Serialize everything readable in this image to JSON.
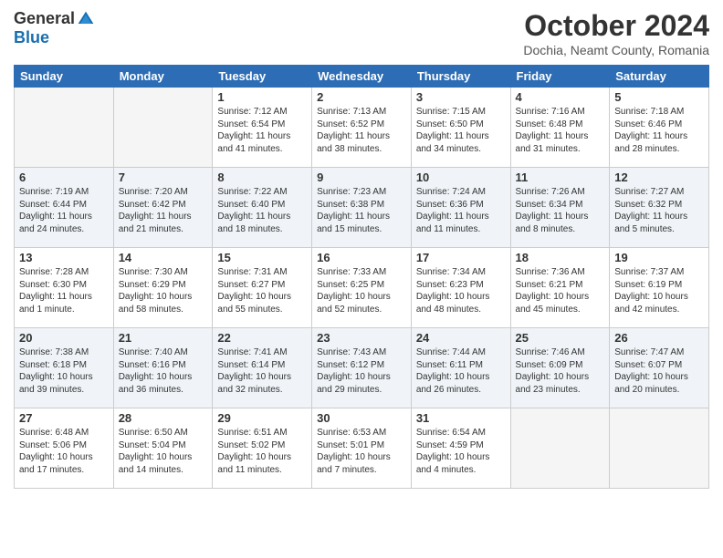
{
  "logo": {
    "general": "General",
    "blue": "Blue"
  },
  "title": "October 2024",
  "location": "Dochia, Neamt County, Romania",
  "weekdays": [
    "Sunday",
    "Monday",
    "Tuesday",
    "Wednesday",
    "Thursday",
    "Friday",
    "Saturday"
  ],
  "weeks": [
    [
      {
        "day": "",
        "empty": true
      },
      {
        "day": "",
        "empty": true
      },
      {
        "day": "1",
        "sunrise": "Sunrise: 7:12 AM",
        "sunset": "Sunset: 6:54 PM",
        "daylight": "Daylight: 11 hours and 41 minutes."
      },
      {
        "day": "2",
        "sunrise": "Sunrise: 7:13 AM",
        "sunset": "Sunset: 6:52 PM",
        "daylight": "Daylight: 11 hours and 38 minutes."
      },
      {
        "day": "3",
        "sunrise": "Sunrise: 7:15 AM",
        "sunset": "Sunset: 6:50 PM",
        "daylight": "Daylight: 11 hours and 34 minutes."
      },
      {
        "day": "4",
        "sunrise": "Sunrise: 7:16 AM",
        "sunset": "Sunset: 6:48 PM",
        "daylight": "Daylight: 11 hours and 31 minutes."
      },
      {
        "day": "5",
        "sunrise": "Sunrise: 7:18 AM",
        "sunset": "Sunset: 6:46 PM",
        "daylight": "Daylight: 11 hours and 28 minutes."
      }
    ],
    [
      {
        "day": "6",
        "sunrise": "Sunrise: 7:19 AM",
        "sunset": "Sunset: 6:44 PM",
        "daylight": "Daylight: 11 hours and 24 minutes."
      },
      {
        "day": "7",
        "sunrise": "Sunrise: 7:20 AM",
        "sunset": "Sunset: 6:42 PM",
        "daylight": "Daylight: 11 hours and 21 minutes."
      },
      {
        "day": "8",
        "sunrise": "Sunrise: 7:22 AM",
        "sunset": "Sunset: 6:40 PM",
        "daylight": "Daylight: 11 hours and 18 minutes."
      },
      {
        "day": "9",
        "sunrise": "Sunrise: 7:23 AM",
        "sunset": "Sunset: 6:38 PM",
        "daylight": "Daylight: 11 hours and 15 minutes."
      },
      {
        "day": "10",
        "sunrise": "Sunrise: 7:24 AM",
        "sunset": "Sunset: 6:36 PM",
        "daylight": "Daylight: 11 hours and 11 minutes."
      },
      {
        "day": "11",
        "sunrise": "Sunrise: 7:26 AM",
        "sunset": "Sunset: 6:34 PM",
        "daylight": "Daylight: 11 hours and 8 minutes."
      },
      {
        "day": "12",
        "sunrise": "Sunrise: 7:27 AM",
        "sunset": "Sunset: 6:32 PM",
        "daylight": "Daylight: 11 hours and 5 minutes."
      }
    ],
    [
      {
        "day": "13",
        "sunrise": "Sunrise: 7:28 AM",
        "sunset": "Sunset: 6:30 PM",
        "daylight": "Daylight: 11 hours and 1 minute."
      },
      {
        "day": "14",
        "sunrise": "Sunrise: 7:30 AM",
        "sunset": "Sunset: 6:29 PM",
        "daylight": "Daylight: 10 hours and 58 minutes."
      },
      {
        "day": "15",
        "sunrise": "Sunrise: 7:31 AM",
        "sunset": "Sunset: 6:27 PM",
        "daylight": "Daylight: 10 hours and 55 minutes."
      },
      {
        "day": "16",
        "sunrise": "Sunrise: 7:33 AM",
        "sunset": "Sunset: 6:25 PM",
        "daylight": "Daylight: 10 hours and 52 minutes."
      },
      {
        "day": "17",
        "sunrise": "Sunrise: 7:34 AM",
        "sunset": "Sunset: 6:23 PM",
        "daylight": "Daylight: 10 hours and 48 minutes."
      },
      {
        "day": "18",
        "sunrise": "Sunrise: 7:36 AM",
        "sunset": "Sunset: 6:21 PM",
        "daylight": "Daylight: 10 hours and 45 minutes."
      },
      {
        "day": "19",
        "sunrise": "Sunrise: 7:37 AM",
        "sunset": "Sunset: 6:19 PM",
        "daylight": "Daylight: 10 hours and 42 minutes."
      }
    ],
    [
      {
        "day": "20",
        "sunrise": "Sunrise: 7:38 AM",
        "sunset": "Sunset: 6:18 PM",
        "daylight": "Daylight: 10 hours and 39 minutes."
      },
      {
        "day": "21",
        "sunrise": "Sunrise: 7:40 AM",
        "sunset": "Sunset: 6:16 PM",
        "daylight": "Daylight: 10 hours and 36 minutes."
      },
      {
        "day": "22",
        "sunrise": "Sunrise: 7:41 AM",
        "sunset": "Sunset: 6:14 PM",
        "daylight": "Daylight: 10 hours and 32 minutes."
      },
      {
        "day": "23",
        "sunrise": "Sunrise: 7:43 AM",
        "sunset": "Sunset: 6:12 PM",
        "daylight": "Daylight: 10 hours and 29 minutes."
      },
      {
        "day": "24",
        "sunrise": "Sunrise: 7:44 AM",
        "sunset": "Sunset: 6:11 PM",
        "daylight": "Daylight: 10 hours and 26 minutes."
      },
      {
        "day": "25",
        "sunrise": "Sunrise: 7:46 AM",
        "sunset": "Sunset: 6:09 PM",
        "daylight": "Daylight: 10 hours and 23 minutes."
      },
      {
        "day": "26",
        "sunrise": "Sunrise: 7:47 AM",
        "sunset": "Sunset: 6:07 PM",
        "daylight": "Daylight: 10 hours and 20 minutes."
      }
    ],
    [
      {
        "day": "27",
        "sunrise": "Sunrise: 6:48 AM",
        "sunset": "Sunset: 5:06 PM",
        "daylight": "Daylight: 10 hours and 17 minutes."
      },
      {
        "day": "28",
        "sunrise": "Sunrise: 6:50 AM",
        "sunset": "Sunset: 5:04 PM",
        "daylight": "Daylight: 10 hours and 14 minutes."
      },
      {
        "day": "29",
        "sunrise": "Sunrise: 6:51 AM",
        "sunset": "Sunset: 5:02 PM",
        "daylight": "Daylight: 10 hours and 11 minutes."
      },
      {
        "day": "30",
        "sunrise": "Sunrise: 6:53 AM",
        "sunset": "Sunset: 5:01 PM",
        "daylight": "Daylight: 10 hours and 7 minutes."
      },
      {
        "day": "31",
        "sunrise": "Sunrise: 6:54 AM",
        "sunset": "Sunset: 4:59 PM",
        "daylight": "Daylight: 10 hours and 4 minutes."
      },
      {
        "day": "",
        "empty": true
      },
      {
        "day": "",
        "empty": true
      }
    ]
  ]
}
